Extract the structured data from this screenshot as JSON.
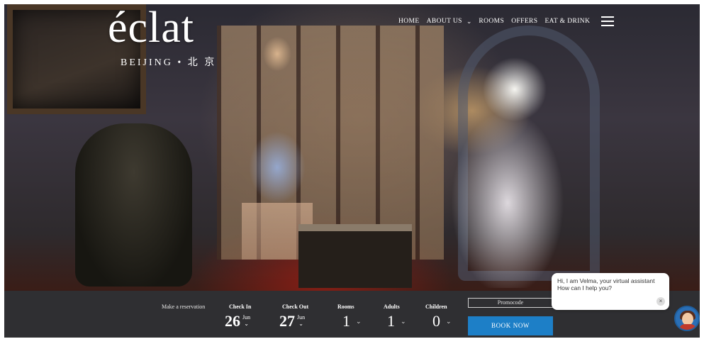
{
  "brand": {
    "name": "éclat",
    "location": "BEIJING • 北 京"
  },
  "nav": {
    "items": [
      "HOME",
      "ABOUT US",
      "ROOMS",
      "OFFERS",
      "EAT & DRINK"
    ],
    "about_chevron": "⌄",
    "menu_icon": "hamburger-icon"
  },
  "booking": {
    "make_reservation": "Make a reservation",
    "check_in": {
      "label": "Check In",
      "day": "26",
      "month": "Jun"
    },
    "check_out": {
      "label": "Check Out",
      "day": "27",
      "month": "Jun"
    },
    "rooms": {
      "label": "Rooms",
      "value": "1"
    },
    "adults": {
      "label": "Adults",
      "value": "1"
    },
    "children": {
      "label": "Children",
      "value": "0"
    },
    "promocode_placeholder": "Promocode",
    "book_now": "BOOK NOW",
    "accent_color": "#1d7fc7"
  },
  "chat": {
    "line1": "Hi, I am Velma, your virtual assistant",
    "line2": "How can I help you?",
    "close": "×"
  }
}
